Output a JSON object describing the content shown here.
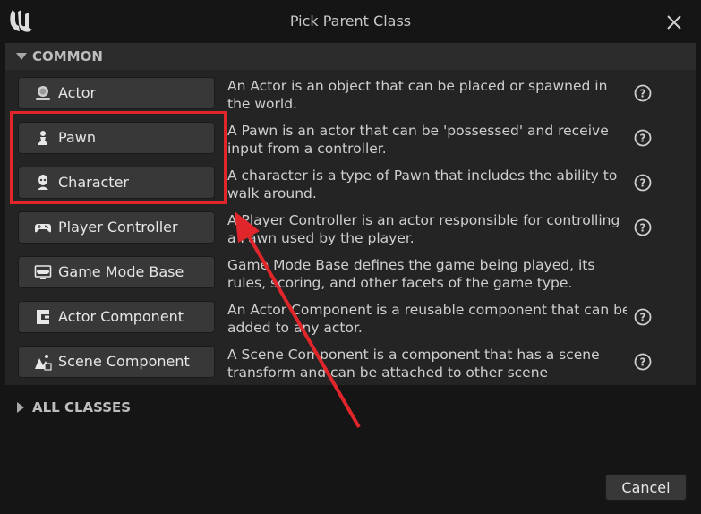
{
  "window": {
    "title": "Pick Parent Class"
  },
  "common_section": {
    "label": "COMMON",
    "items": [
      {
        "label": "Actor",
        "icon": "actor-icon",
        "description": [
          "An Actor is an object that can be placed or spawned in",
          "the world."
        ]
      },
      {
        "label": "Pawn",
        "icon": "pawn-icon",
        "description": [
          "A Pawn is an actor that can be 'possessed' and receive",
          "input from a controller."
        ]
      },
      {
        "label": "Character",
        "icon": "character-icon",
        "description": [
          "A character is a type of Pawn that includes the ability to",
          "walk around."
        ]
      },
      {
        "label": "Player Controller",
        "icon": "gamepad-icon",
        "description": [
          "A Player Controller is an actor responsible for controlling",
          "a Pawn used by the player."
        ]
      },
      {
        "label": "Game Mode Base",
        "icon": "game-mode-icon",
        "description": [
          "Game Mode Base defines the game being played, its",
          "rules, scoring, and other facets of the game type."
        ]
      },
      {
        "label": "Actor Component",
        "icon": "component-icon",
        "description": [
          "An Actor Component is a reusable component that can be",
          "added to any actor."
        ]
      },
      {
        "label": "Scene Component",
        "icon": "scene-component-icon",
        "description": [
          "A Scene Component is a component that has a scene",
          "transform and can be attached to other scene"
        ]
      }
    ]
  },
  "all_classes_section": {
    "label": "ALL CLASSES"
  },
  "footer": {
    "cancel_label": "Cancel"
  },
  "annotation": {
    "highlight_color": "#e0262b"
  }
}
